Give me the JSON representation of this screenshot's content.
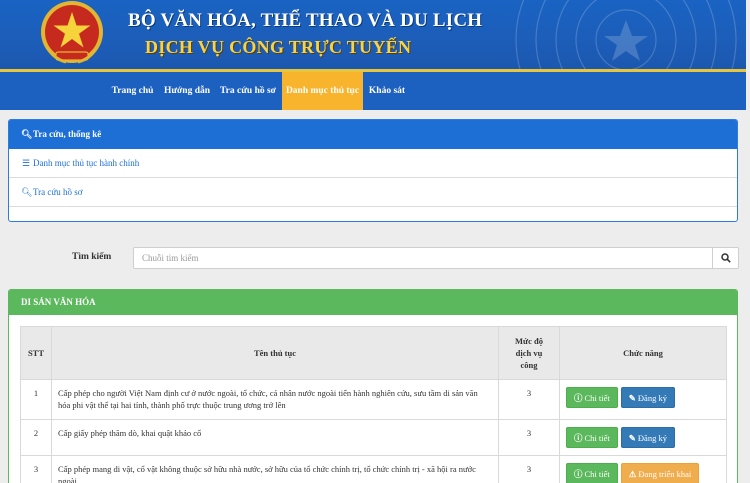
{
  "header": {
    "title": "BỘ VĂN HÓA, THỂ THAO VÀ DU LỊCH",
    "subtitle": "DỊCH VỤ CÔNG TRỰC TUYẾN",
    "colors": {
      "header_bg": "#1b5fbb",
      "accent_gold": "#f5d34a"
    }
  },
  "nav": {
    "items": [
      {
        "label": "Trang chủ"
      },
      {
        "label": "Hướng dẫn"
      },
      {
        "label": "Tra cứu hồ sơ"
      },
      {
        "label": "Danh mục thủ tục",
        "active": true
      },
      {
        "label": "Khảo sát"
      }
    ]
  },
  "sidebar": {
    "heading": "Tra cứu, thống kê",
    "items": [
      {
        "label": "Danh mục thủ tục hành chính",
        "icon": "list-icon"
      },
      {
        "label": "Tra cứu hồ sơ",
        "icon": "search-icon"
      }
    ]
  },
  "search": {
    "label": "Tìm kiếm",
    "placeholder": "Chuỗi tìm kiếm",
    "value": ""
  },
  "section": {
    "title": "DI SẢN VĂN HÓA",
    "columns": [
      "STT",
      "Tên thủ tục",
      "Mức độ dịch vụ công",
      "Chức năng"
    ],
    "rows": [
      {
        "stt": "1",
        "name": "Cấp phép cho người Việt Nam định cư ở nước ngoài, tổ chức, cá nhân nước ngoài tiến hành nghiên cứu, sưu tầm di sản văn hóa phi vật thể tại hai tỉnh, thành phố trực thuộc trung ương trở lên",
        "level": "3",
        "actions": [
          {
            "label": "Chi tiết",
            "style": "green",
            "icon": "info-icon"
          },
          {
            "label": "Đăng ký",
            "style": "blue",
            "icon": "edit-icon"
          }
        ]
      },
      {
        "stt": "2",
        "name": "Cấp giấy phép thăm dò, khai quật khảo cổ",
        "level": "3",
        "actions": [
          {
            "label": "Chi tiết",
            "style": "green",
            "icon": "info-icon"
          },
          {
            "label": "Đăng ký",
            "style": "blue",
            "icon": "edit-icon"
          }
        ]
      },
      {
        "stt": "3",
        "name": "Cấp phép mang di vật, cổ vật không thuộc sở hữu nhà nước, sở hữu của tổ chức chính trị, tổ chức chính trị - xã hội ra nước ngoài",
        "level": "3",
        "actions": [
          {
            "label": "Chi tiết",
            "style": "green",
            "icon": "info-icon"
          },
          {
            "label": "Đang triển khai",
            "style": "orange",
            "icon": "warning-icon"
          }
        ]
      }
    ]
  }
}
